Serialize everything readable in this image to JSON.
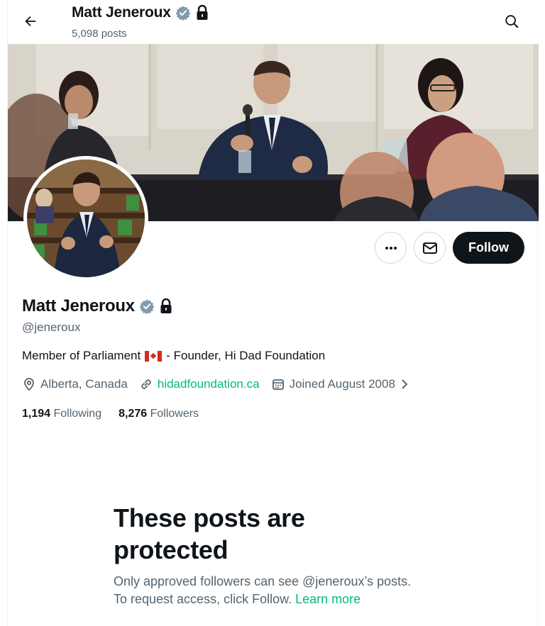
{
  "header": {
    "back_icon": "arrow-left-icon",
    "name": "Matt Jeneroux",
    "post_count": "5,098 posts",
    "search_icon": "search-icon",
    "verified_icon": "verified-badge-icon",
    "lock_icon": "lock-icon"
  },
  "profile": {
    "name": "Matt Jeneroux",
    "handle": "@jeneroux",
    "bio_before_flag": "Member of Parliament",
    "bio_flag": "canada-flag-icon",
    "bio_after_flag": "- Founder, Hi Dad Foundation",
    "location": "Alberta, Canada",
    "website": "hidadfoundation.ca",
    "joined": "Joined August 2008",
    "following_count": "1,194",
    "following_label": "Following",
    "followers_count": "8,276",
    "followers_label": "Followers"
  },
  "actions": {
    "more_icon": "more-icon",
    "message_icon": "envelope-icon",
    "follow_label": "Follow"
  },
  "protected": {
    "title": "These posts are protected",
    "line1": "Only approved followers can see @jeneroux’s posts.",
    "line2_prefix": "To request access, click Follow.",
    "learn_more": "Learn more"
  },
  "colors": {
    "accent": "#00ba7c",
    "text": "#0f1419",
    "muted": "#536471",
    "verified": "#829aab"
  }
}
